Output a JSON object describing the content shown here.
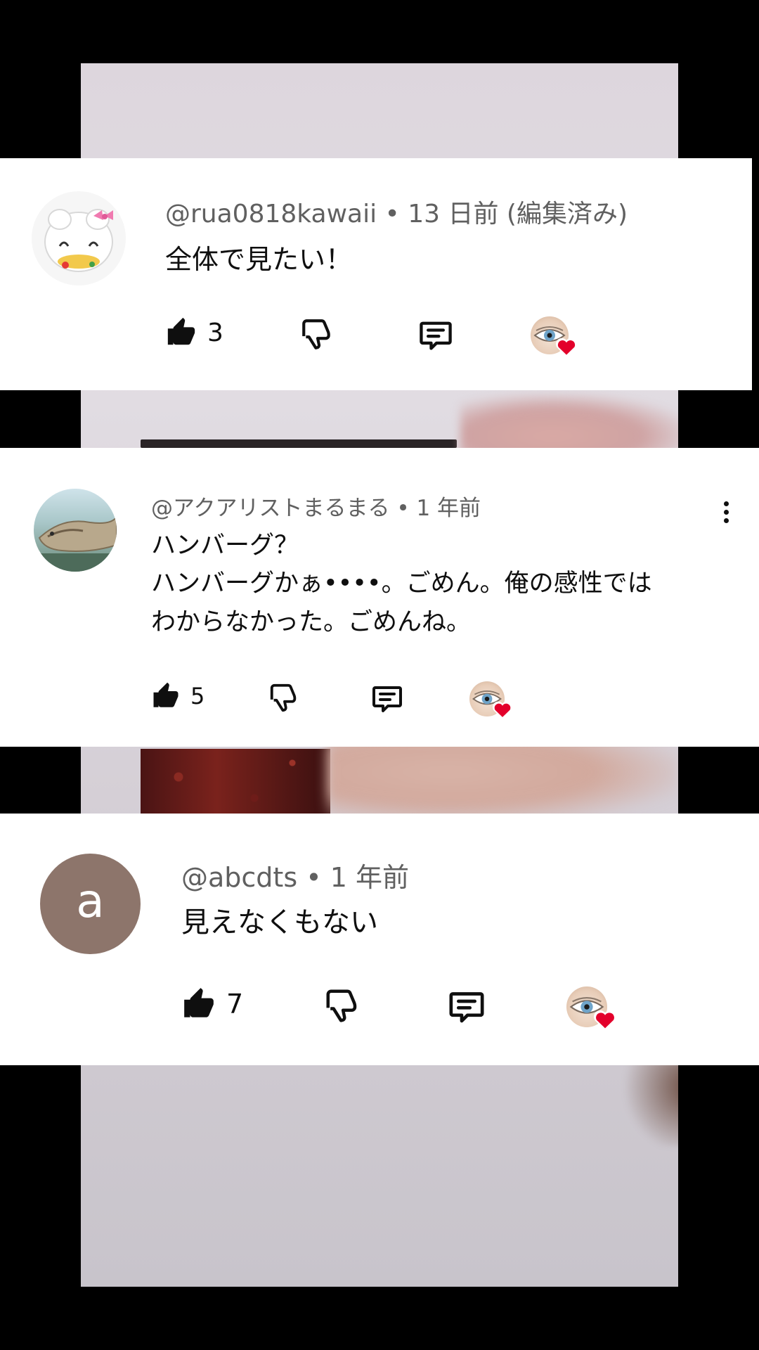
{
  "comments": [
    {
      "handle": "@rua0818kawaii",
      "separator": "•",
      "time": "13 日前 (編集済み)",
      "text": "全体で見たい！",
      "likes": "3",
      "avatar_icon": "cartoon-character-avatar"
    },
    {
      "handle": "@アクアリストまるまる",
      "separator": "•",
      "time": "1 年前",
      "text": "ハンバーグ？\nハンバーグかぁ••••。ごめん。俺の感性では\nわからなかった。ごめんね。",
      "likes": "5",
      "avatar_icon": "crocodile-photo-avatar"
    },
    {
      "handle": "@abcdts",
      "separator": "•",
      "time": "1 年前",
      "text": "見えなくもない",
      "likes": "7",
      "avatar_letter": "a",
      "avatar_color": "#8d756b"
    }
  ],
  "icons": {
    "like": "thumbs-up-icon",
    "dislike": "thumbs-down-icon",
    "reply": "reply-icon",
    "creator_heart": "heart-icon",
    "more": "more-vert-icon"
  },
  "colors": {
    "heart": "#e3002b",
    "meta_text": "#606060",
    "body_text": "#0f0f0f"
  }
}
